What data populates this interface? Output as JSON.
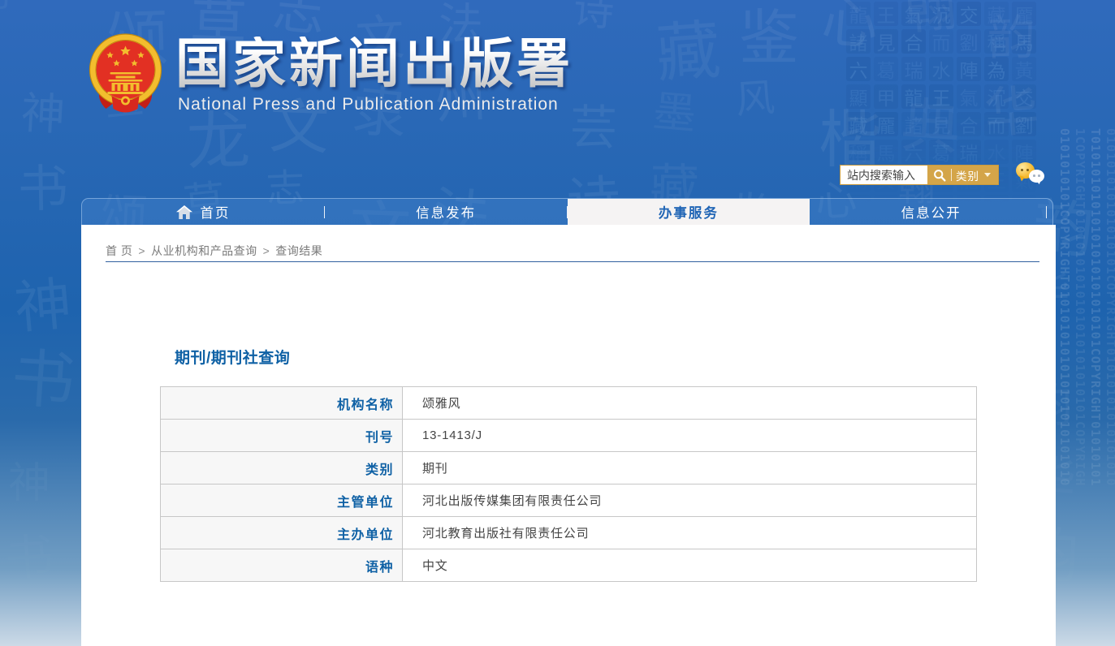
{
  "header": {
    "site_title_cn": "国家新闻出版署",
    "site_title_en": "National  Press and Publication Administration"
  },
  "search": {
    "placeholder": "站内搜索输入",
    "category_label": "类别"
  },
  "nav": {
    "tabs": [
      {
        "label": "首页"
      },
      {
        "label": "信息发布"
      },
      {
        "label": "办事服务"
      },
      {
        "label": "信息公开"
      }
    ]
  },
  "breadcrumb": {
    "separator": ">",
    "items": [
      "首 页",
      "从业机构和产品查询",
      "查询结果"
    ]
  },
  "content": {
    "section_title": "期刊/期刊社查询",
    "table": {
      "rows": [
        {
          "label": "机构名称",
          "value": "颂雅风"
        },
        {
          "label": "刊号",
          "value": "13-1413/J"
        },
        {
          "label": "类别",
          "value": "期刊"
        },
        {
          "label": "主管单位",
          "value": "河北出版传媒集团有限责任公司"
        },
        {
          "label": "主办单位",
          "value": "河北教育出版社有限责任公司"
        },
        {
          "label": "语种",
          "value": "中文"
        }
      ]
    }
  },
  "colors": {
    "accent_blue": "#0f61a5",
    "label_blue": "#1565ae",
    "gold": "#d4a549"
  },
  "background": {
    "calligraphy_glyphs": "书法翰墨文风雅颂诗韵篆隶楷行草藏气神州典籍志鉴录宝芸华章文心雕龙墨海",
    "seal_glyphs": "龍見瑞王合水氣而陣沉劉為交稱黃藏馬顯龎六甲諸葛",
    "binary_motif": "0101010101COPYRIGHT0101010101010101"
  }
}
